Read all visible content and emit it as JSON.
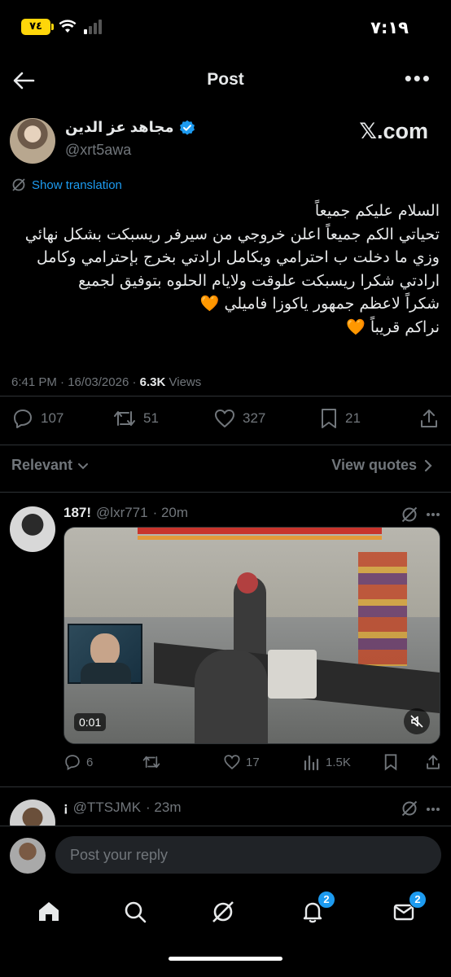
{
  "status_bar": {
    "time": "٧:١٩",
    "battery": "٧٤"
  },
  "header": {
    "title": "Post",
    "more": "•••"
  },
  "author": {
    "name": "مجاهد عز الدين",
    "handle": "@xrt5awa",
    "brand": "𝕏.com"
  },
  "translate_label": "Show translation",
  "post_lines": [
    "السلام عليكم جميعاً",
    "تحياتي الكم جميعاً اعلن خروجي من سيرفر ريسبكت بشكل نهائي",
    "وزي ما دخلت ب احترامي وبكامل ارادتي بخرج بإحترامي وكامل",
    "ارادتي شكرا ريسبكت علوقت ولايام الحلوه بتوفيق لجميع",
    "شكراً لاعظم جمهور ياكوزا فاميلي 🧡",
    "نراكم قريباً 🧡"
  ],
  "meta": {
    "time": "6:41 PM",
    "sep": "·",
    "date": "16/03/2026",
    "views_count": "6.3K",
    "views_label": "Views"
  },
  "actions": {
    "replies": "107",
    "reposts": "51",
    "likes": "327",
    "bookmarks": "21"
  },
  "filter": {
    "relevant": "Relevant",
    "view_quotes": "View quotes"
  },
  "reply1": {
    "name": "187!",
    "handle": "@lxr771",
    "time": "· 20m",
    "video_time": "0:01",
    "replies": "6",
    "reposts": "",
    "likes": "17",
    "views": "1.5K"
  },
  "reply2": {
    "name": "¡",
    "handle": "@TTSJMK",
    "time": "· 23m"
  },
  "composer": {
    "placeholder": "Post your reply"
  },
  "nav": {
    "notifications_badge": "2",
    "messages_badge": "2"
  },
  "colors": {
    "accent": "#1d9bf0",
    "muted": "#71767b",
    "divider": "#2f3336",
    "heart": "#ff8c1a"
  }
}
